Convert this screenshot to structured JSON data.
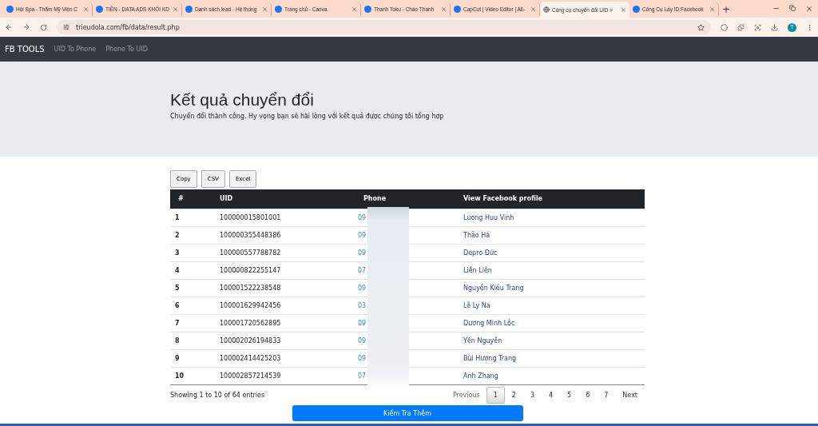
{
  "browser": {
    "tabs": [
      {
        "title": "Hội Spa - Thẩm Mỹ Viện C",
        "selected": false
      },
      {
        "title": "TIỀN - DATA ADS KHỐI KD",
        "selected": false
      },
      {
        "title": "Danh sách lead - Hệ thống",
        "selected": false
      },
      {
        "title": "Trang chủ - Canva",
        "selected": false
      },
      {
        "title": "Thanh Toku - Chào Thanh",
        "selected": false
      },
      {
        "title": "CapCut | Video Editor | All-",
        "selected": false
      },
      {
        "title": "Công cụ chuyển đổi UID >",
        "selected": true
      },
      {
        "title": "Công Cụ Lấy ID Facebook",
        "selected": false
      }
    ],
    "new_tab": "+",
    "url": "trieudola.com/fb/data/result.php",
    "avatar": "T"
  },
  "navbar": {
    "brand": "FB TOOLS",
    "links": [
      "UID To Phone",
      "Phone To UID"
    ]
  },
  "header": {
    "title": "Kết quả chuyển đổi",
    "subtitle": "Chuyển đổi thành công. Hy vọng bạn sẽ hài lòng với kết quả được chúng tôi tổng hợp"
  },
  "export_buttons": [
    "Copy",
    "CSV",
    "Excel"
  ],
  "table": {
    "columns": [
      "#",
      "UID",
      "Phone",
      "View Facebook profile"
    ],
    "rows": [
      [
        "1",
        "100000015801001",
        "09",
        "Luong Huu Vinh"
      ],
      [
        "2",
        "100000355448386",
        "09",
        "Thảo Hà"
      ],
      [
        "3",
        "100000557788782",
        "09",
        "Depro Đức"
      ],
      [
        "4",
        "100000822255147",
        "07",
        "Liên Liên"
      ],
      [
        "5",
        "100001522238548",
        "09",
        "Nguyễn Kiều Trang"
      ],
      [
        "6",
        "100001629942456",
        "03",
        "Lê Ly Na"
      ],
      [
        "7",
        "100001720562895",
        "09",
        "Dương Minh Lộc"
      ],
      [
        "8",
        "100002026194833",
        "09",
        "Yến Nguyễn"
      ],
      [
        "9",
        "100002414425203",
        "09",
        "Bùi Hương Trang"
      ],
      [
        "10",
        "100002857214539",
        "07",
        "Anh Zhang"
      ]
    ]
  },
  "info": "Showing 1 to 10 of 64 entries",
  "pagination": {
    "previous": "Previous",
    "pages": [
      {
        "label": "1",
        "selected": true
      },
      {
        "label": "2",
        "selected": false
      },
      {
        "label": "3",
        "selected": false
      },
      {
        "label": "4",
        "selected": false
      },
      {
        "label": "5",
        "selected": false
      },
      {
        "label": "6",
        "selected": false
      },
      {
        "label": "7",
        "selected": false
      }
    ],
    "next": "Next"
  },
  "action_button": "Kiểm Tra Thêm"
}
